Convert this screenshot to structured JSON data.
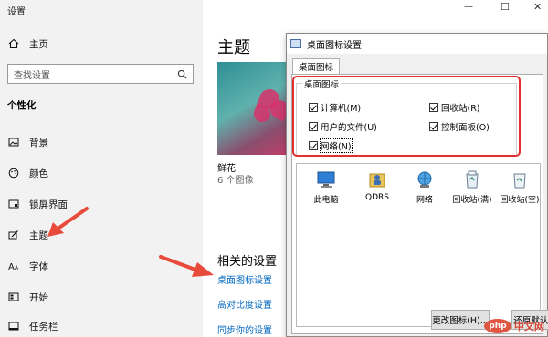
{
  "sidebar": {
    "app_title": "设置",
    "home_label": "主页",
    "search_placeholder": "查找设置",
    "section_title": "个性化",
    "items": [
      {
        "label": "背景",
        "icon": "picture-icon"
      },
      {
        "label": "颜色",
        "icon": "palette-icon"
      },
      {
        "label": "锁屏界面",
        "icon": "lockscreen-icon"
      },
      {
        "label": "主题",
        "icon": "brush-icon"
      },
      {
        "label": "字体",
        "icon": "font-icon"
      },
      {
        "label": "开始",
        "icon": "start-icon"
      },
      {
        "label": "任务栏",
        "icon": "taskbar-icon"
      }
    ]
  },
  "main": {
    "title": "主题",
    "theme_name": "鲜花",
    "theme_count": "6 个图像",
    "related_title": "相关的设置",
    "links": [
      "桌面图标设置",
      "高对比度设置",
      "同步你的设置"
    ]
  },
  "dialog": {
    "title": "桌面图标设置",
    "tab": "桌面图标",
    "group_label": "桌面图标",
    "checkboxes": [
      {
        "label": "计算机(M)",
        "checked": true
      },
      {
        "label": "回收站(R)",
        "checked": true
      },
      {
        "label": "用户的文件(U)",
        "checked": true
      },
      {
        "label": "控制面板(O)",
        "checked": true
      },
      {
        "label": "网络(N)",
        "checked": true
      }
    ],
    "icons": [
      "此电脑",
      "QDRS",
      "网络",
      "回收站(满)",
      "回收站(空)"
    ],
    "buttons": {
      "change_icon": "更改图标(H)...",
      "restore_default": "还原默认值"
    }
  },
  "window_controls": {
    "minimize": "—",
    "maximize": "☐",
    "close": "✕"
  },
  "watermark": {
    "brand": "php",
    "text": "中文网"
  },
  "colors": {
    "accent_link": "#0067c0",
    "highlight_red": "#e03030",
    "arrow_red": "#e84a3c"
  }
}
